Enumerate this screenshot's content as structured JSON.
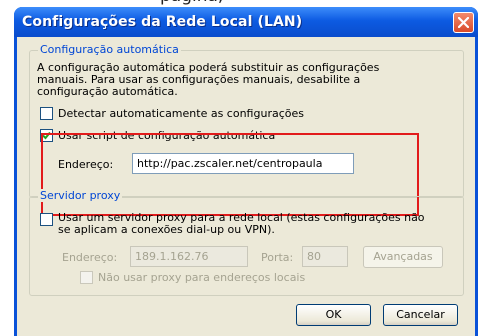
{
  "colors": {
    "titlebar": "#0a52d8",
    "legend": "#0046d5",
    "highlight": "#e21b1b",
    "dialog_bg": "#ece9d8"
  },
  "dialog": {
    "title": "Configurações da Rede Local (LAN)",
    "close_icon": "close-icon"
  },
  "auto_config": {
    "legend": "Configuração automática",
    "description_lines": [
      "A configuração automática poderá substituir as configurações",
      "manuais. Para usar as configurações manuais, desabilite a",
      "configuração automática."
    ],
    "detect_label": "Detectar automaticamente as configurações",
    "detect_checked": false,
    "script_label": "Usar script de configuração automática",
    "script_checked": true,
    "address_label": "Endereço:",
    "address_value": "http://pac.zscaler.net/centropaula"
  },
  "proxy": {
    "legend": "Servidor proxy",
    "use_proxy_label_line1": "Usar um servidor proxy para a rede local (estas configurações não",
    "use_proxy_label_line2": "se aplicam a conexões dial-up ou VPN).",
    "use_proxy_checked": false,
    "address_label": "Endereço:",
    "address_value": "189.1.162.76",
    "port_label": "Porta:",
    "port_value": "80",
    "advanced_label": "Avançadas",
    "bypass_label": "Não usar proxy para endereços locais",
    "bypass_checked": false
  },
  "buttons": {
    "ok": "OK",
    "cancel": "Cancelar"
  }
}
